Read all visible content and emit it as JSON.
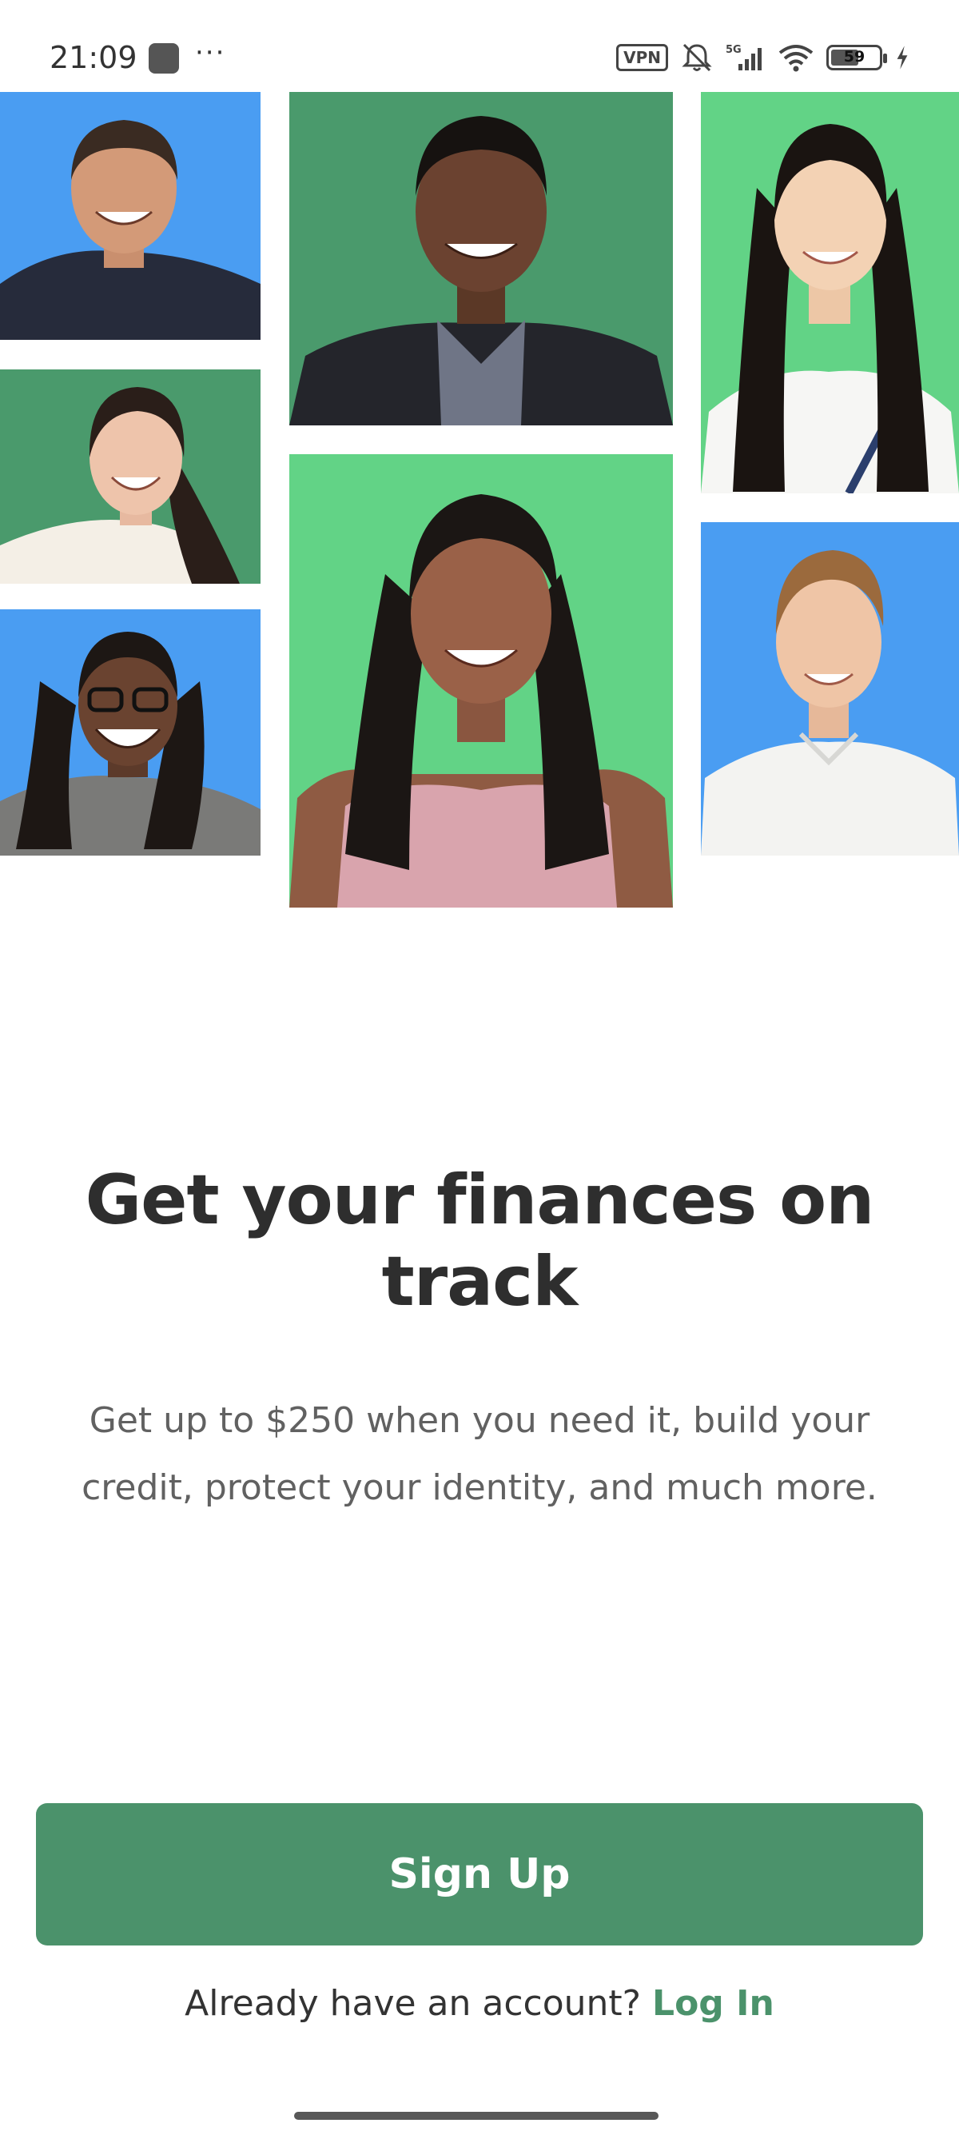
{
  "status_bar": {
    "time": "21:09",
    "more": "···",
    "vpn_label": "VPN",
    "network_label": "5G",
    "battery_level": "59",
    "battery_fraction": 0.59,
    "icons": [
      "app-notification-icon",
      "mute-bell-icon",
      "signal-icon",
      "wifi-icon",
      "battery-icon",
      "charging-icon"
    ]
  },
  "mosaic": {
    "tiles": [
      {
        "name": "photo-man-smiling",
        "bg": "#4a9df2"
      },
      {
        "name": "photo-woman-dark-ponytail",
        "bg": "#4a9a6c"
      },
      {
        "name": "photo-woman-glasses-braids",
        "bg": "#4a9df2"
      },
      {
        "name": "photo-man-suit",
        "bg": "#4a9a6c"
      },
      {
        "name": "photo-woman-pink-top",
        "bg": "#62d386"
      },
      {
        "name": "photo-woman-long-hair",
        "bg": "#62d386"
      },
      {
        "name": "photo-young-man-blonde",
        "bg": "#4a9df2"
      }
    ]
  },
  "hero": {
    "title": "Get your finances on track",
    "subtitle": "Get up to $250 when you need it, build your credit, protect your identity, and much more."
  },
  "actions": {
    "signup_label": "Sign Up",
    "login_prompt": "Already have an account?",
    "login_label": "Log In"
  },
  "colors": {
    "brand_green": "#4b926b",
    "tile_blue": "#4a9df2",
    "tile_dark_green": "#4a9a6c",
    "tile_light_green": "#62d386"
  }
}
